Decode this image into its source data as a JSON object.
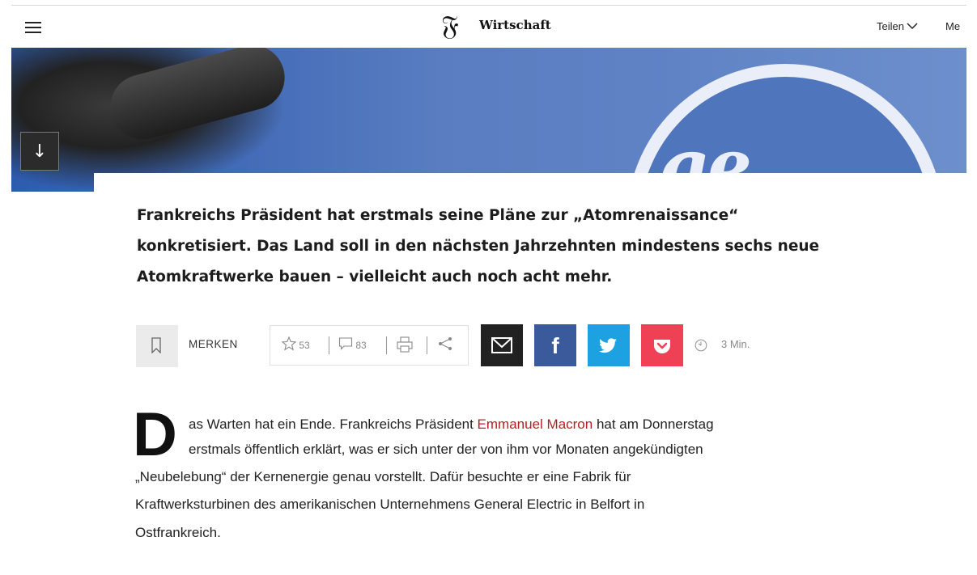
{
  "header": {
    "menu_icon": "hamburger-icon",
    "logo_glyph": "𝔉",
    "section": "Wirtschaft",
    "share_label": "Teilen",
    "more_label": "Me"
  },
  "hero": {
    "scroll_glyph": "↓"
  },
  "teaser": {
    "lines": [
      "Frankreichs Präsident hat erstmals seine Pläne zur „Atomrenaissance“",
      "konkretisiert. Das Land soll in den nächsten Jahrzehnten mindestens sechs neue",
      "Atomkraftwerke bauen – vielleicht auch noch acht mehr."
    ]
  },
  "toolbar": {
    "bookmark_label": "MERKEN",
    "rating_count": "53",
    "comment_count": "83",
    "facebook_glyph": "f",
    "read_time": "3 Min.",
    "colors": {
      "mail": "#222222",
      "facebook": "#3b5a9b",
      "twitter": "#1da1e0",
      "pocket": "#ef4056"
    }
  },
  "article": {
    "dropcap": "D",
    "line1_pre": "as Warten hat ein Ende. Frankreichs Präsident ",
    "line1_link": "Emmanuel Macron",
    "line1_post": " hat am Donnerstag",
    "line2": "erstmals öffentlich erklärt, was er sich unter der von ihm vor Monaten angekündigten",
    "line3": "„Neubelebung“ der Kernenergie genau vorstellt. Dafür besuchte er eine Fabrik für",
    "line4": "Kraftwerksturbinen des amerikanischen Unternehmens General Electric in Belfort in",
    "line5": "Ostfrankreich.",
    "link_color": "#b41f22"
  }
}
